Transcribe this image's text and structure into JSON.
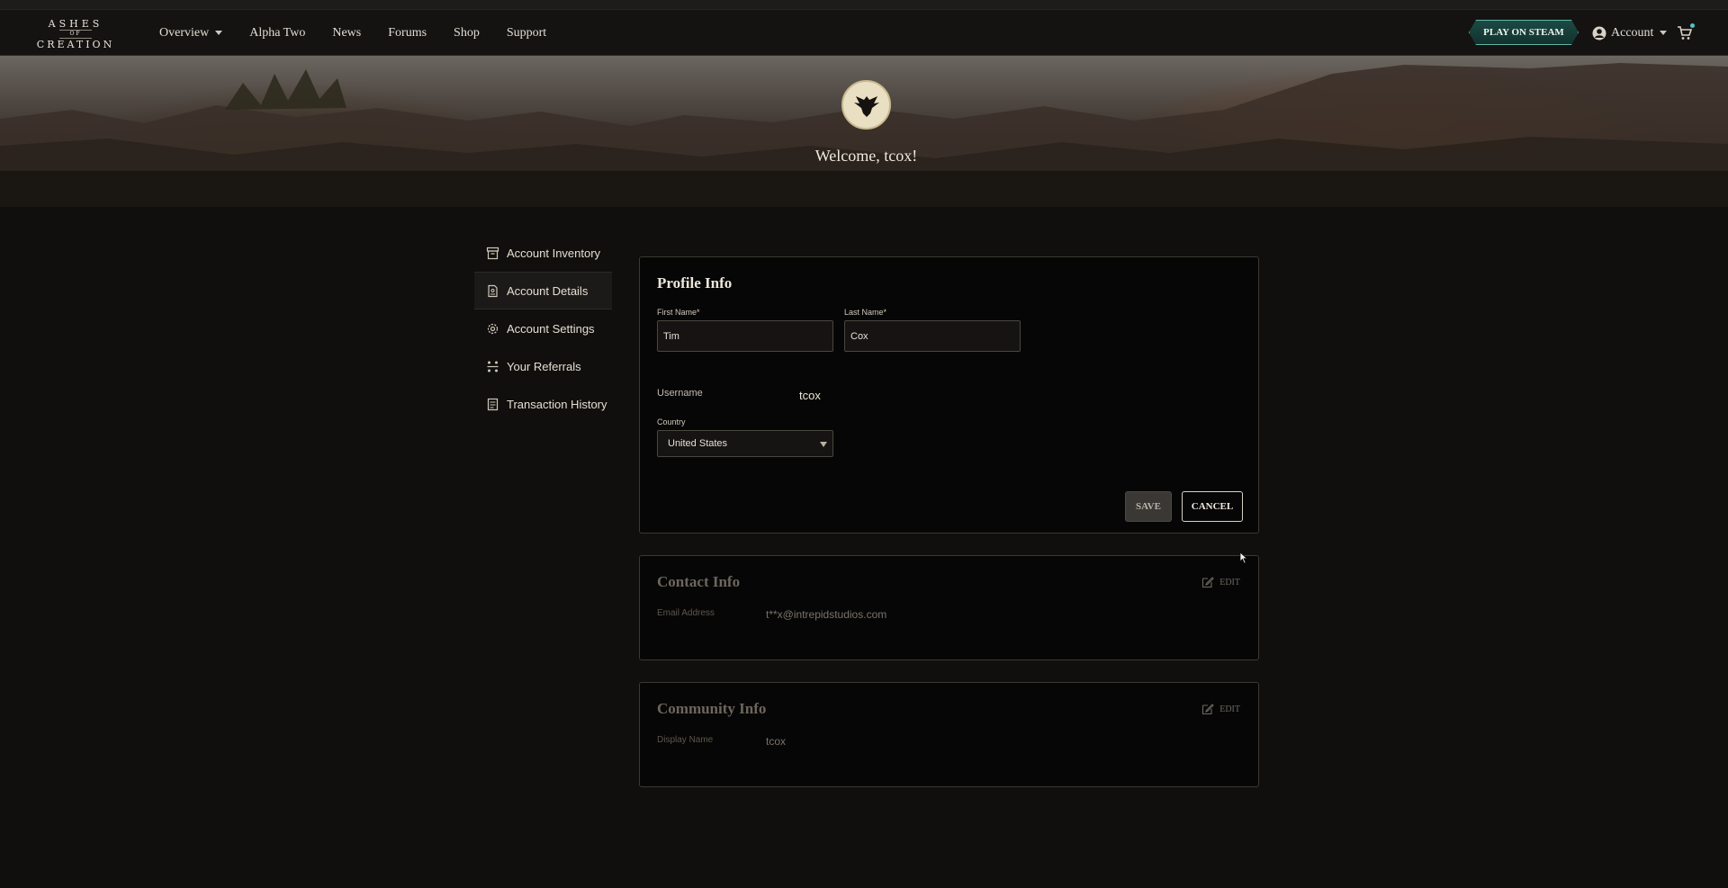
{
  "logo": {
    "line1": "ASHES",
    "line2": "OF",
    "line3": "CREATION"
  },
  "nav": {
    "items": [
      {
        "label": "Overview",
        "has_dropdown": true
      },
      {
        "label": "Alpha Two",
        "has_dropdown": false
      },
      {
        "label": "News",
        "has_dropdown": false
      },
      {
        "label": "Forums",
        "has_dropdown": false
      },
      {
        "label": "Shop",
        "has_dropdown": false
      },
      {
        "label": "Support",
        "has_dropdown": false
      }
    ],
    "steam_button": "PLAY ON STEAM",
    "account_label": "Account",
    "icons": {
      "user": "user-circle-icon",
      "cart": "shopping-cart-icon"
    }
  },
  "hero": {
    "welcome": "Welcome, tcox!",
    "avatar_icon": "eagle-crest-icon"
  },
  "sidebar": {
    "items": [
      {
        "label": "Account Inventory",
        "icon": "archive-box-icon",
        "active": false
      },
      {
        "label": "Account Details",
        "icon": "document-icon",
        "active": true
      },
      {
        "label": "Account Settings",
        "icon": "gear-icon",
        "active": false
      },
      {
        "label": "Your Referrals",
        "icon": "referral-icon",
        "active": false
      },
      {
        "label": "Transaction History",
        "icon": "receipt-icon",
        "active": false
      }
    ]
  },
  "profile": {
    "title": "Profile Info",
    "first_name_label": "First Name*",
    "first_name_value": "Tim",
    "last_name_label": "Last Name*",
    "last_name_value": "Cox",
    "username_label": "Username",
    "username_value": "tcox",
    "country_label": "Country",
    "country_value": "United States",
    "save_label": "SAVE",
    "cancel_label": "CANCEL"
  },
  "contact": {
    "title": "Contact Info",
    "edit_label": "EDIT",
    "email_label": "Email Address",
    "email_value": "t**x@intrepidstudios.com"
  },
  "community": {
    "title": "Community Info",
    "edit_label": "EDIT",
    "display_name_label": "Display Name",
    "display_name_value": "tcox"
  },
  "colors": {
    "background": "#110f0d",
    "steam_accent": "#5fb7a6",
    "panel_border": "#3c3833",
    "cart_badge": "#4fc7c0"
  }
}
